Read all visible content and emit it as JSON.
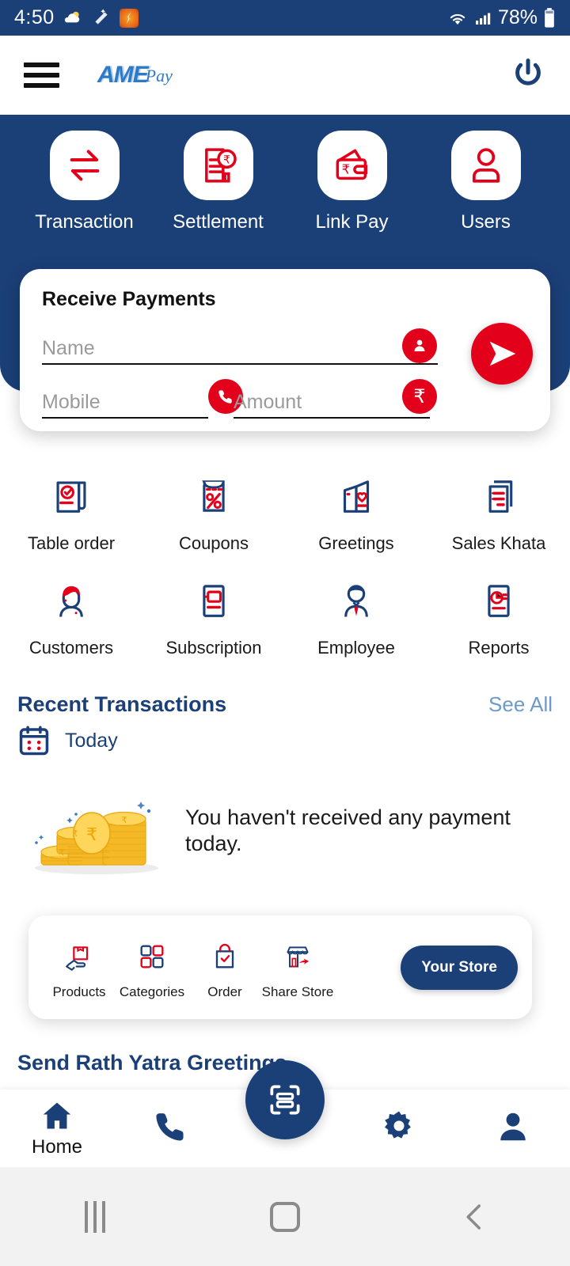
{
  "status_bar": {
    "time": "4:50",
    "battery_percent": "78%",
    "icons_left": [
      "weather-icon",
      "magic-wand-icon",
      "pizza-app-icon"
    ],
    "icons_right": [
      "wifi-icon",
      "signal-icon",
      "battery-icon"
    ]
  },
  "app_bar": {
    "menu_icon": "hamburger-menu-icon",
    "logo_primary": "AME",
    "logo_secondary": "Pay",
    "power_icon": "power-icon"
  },
  "quick_actions": [
    {
      "label": "Transaction",
      "icon": "transfer-arrows-icon"
    },
    {
      "label": "Settlement",
      "icon": "invoice-rupee-icon"
    },
    {
      "label": "Link Pay",
      "icon": "wallet-rupee-icon"
    },
    {
      "label": "Users",
      "icon": "user-icon"
    }
  ],
  "receive_payments": {
    "title": "Receive Payments",
    "name_value": "",
    "name_placeholder": "Name",
    "name_icon": "contact-icon",
    "mobile_value": "",
    "mobile_placeholder": "Mobile",
    "mobile_icon": "phone-icon",
    "amount_value": "",
    "amount_placeholder": "Amount",
    "amount_icon": "rupee-icon",
    "send_icon": "send-arrow-icon"
  },
  "features": [
    {
      "label": "Table order",
      "icon": "order-receipt-icon"
    },
    {
      "label": "Coupons",
      "icon": "coupon-percent-icon"
    },
    {
      "label": "Greetings",
      "icon": "greeting-card-heart-icon"
    },
    {
      "label": "Sales Khata",
      "icon": "ledger-pages-icon"
    },
    {
      "label": "Customers",
      "icon": "customer-person-icon"
    },
    {
      "label": "Subscription",
      "icon": "subscription-card-icon"
    },
    {
      "label": "Employee",
      "icon": "employee-tie-icon"
    },
    {
      "label": "Reports",
      "icon": "report-chart-icon"
    }
  ],
  "recent_transactions": {
    "title": "Recent Transactions",
    "see_all": "See All",
    "calendar_icon": "calendar-icon",
    "day_label": "Today",
    "empty_message": "You haven't received any payment today.",
    "empty_illustration": "coins-stack-illustration"
  },
  "store_bar": {
    "items": [
      {
        "label": "Products",
        "icon": "products-hand-box-icon"
      },
      {
        "label": "Categories",
        "icon": "categories-grid-icon"
      },
      {
        "label": "Order",
        "icon": "order-bag-check-icon"
      },
      {
        "label": "Share Store",
        "icon": "share-store-icon"
      }
    ],
    "button_label": "Your Store"
  },
  "greetings_section": {
    "title": "Send Rath Yatra Greetings"
  },
  "bottom_nav": {
    "items": [
      {
        "label": "Home",
        "icon": "home-icon",
        "active": true
      },
      {
        "label": "",
        "icon": "phone-icon",
        "active": false
      },
      {
        "label": "",
        "icon": "settings-gear-icon",
        "active": false
      },
      {
        "label": "",
        "icon": "profile-person-icon",
        "active": false
      }
    ],
    "scan_icon": "qr-scan-icon"
  },
  "system_nav": {
    "recent_icon": "recents-icon",
    "home_icon": "home-square-icon",
    "back_icon": "back-chevron-icon"
  },
  "colors": {
    "brand_blue": "#1b3f77",
    "brand_red": "#e3001b",
    "logo_blue": "#2f7ac7",
    "link_blue": "#6e9ac8",
    "system_nav_bg": "#f2f2f2"
  }
}
